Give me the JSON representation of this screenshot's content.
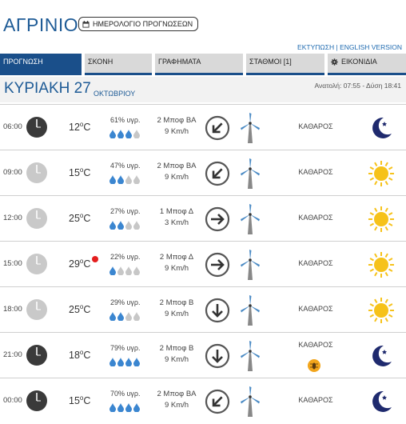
{
  "header": {
    "city": "ΑΓΡΙΝΙΟ",
    "calendar_button": "ΗΜΕΡΟΛΟΓΙΟ ΠΡΟΓΝΩΣΕΩΝ",
    "print_links": "ΕΚΤΥΠΩΣΗ | ENGLISH VERSION"
  },
  "tabs": [
    {
      "label": "ΠΡΟΓΝΩΣΗ",
      "active": true
    },
    {
      "label": "ΣΚΟΝΗ"
    },
    {
      "label": "ΓΡΑΦΗΜΑΤΑ"
    },
    {
      "label": "ΣΤΑΘΜΟΙ [1]"
    },
    {
      "label": "ΕΙΚΟΝΙΔΙΑ",
      "icon": "gear-icon"
    }
  ],
  "day": {
    "title": "ΚΥΡΙΑΚΗ 27",
    "month": "ΟΚΤΩΒΡΙΟΥ",
    "sun": "Ανατολή: 07:55 - Δύση 18:41"
  },
  "colors": {
    "accent": "#1a4f8a",
    "title_blue": "#1e5b96",
    "drop_blue": "#3b86d0",
    "drop_gray": "#c7c7c7",
    "rain_dot": "#e41e1e",
    "sun": "#f6c21a",
    "moon": "#1f2a6e"
  },
  "rows": [
    {
      "time": "06:00",
      "night": true,
      "temp": "12",
      "humidity": "61% υγρ.",
      "drops": 3,
      "wind_bft": "2 Μποφ ΒΑ",
      "wind_kmh": "9 Km/h",
      "wind_dir": "southwest",
      "condition": "ΚΑΘΑΡΟΣ",
      "icon": "moon-icon",
      "rain": false
    },
    {
      "time": "09:00",
      "night": false,
      "temp": "15",
      "humidity": "47% υγρ.",
      "drops": 2,
      "wind_bft": "2 Μποφ ΒΑ",
      "wind_kmh": "9 Km/h",
      "wind_dir": "southwest",
      "condition": "ΚΑΘΑΡΟΣ",
      "icon": "sun-icon",
      "rain": false
    },
    {
      "time": "12:00",
      "night": false,
      "temp": "25",
      "humidity": "27% υγρ.",
      "drops": 2,
      "wind_bft": "1 Μποφ Δ",
      "wind_kmh": "3 Km/h",
      "wind_dir": "east",
      "condition": "ΚΑΘΑΡΟΣ",
      "icon": "sun-icon",
      "rain": false
    },
    {
      "time": "15:00",
      "night": false,
      "temp": "29",
      "humidity": "22% υγρ.",
      "drops": 1,
      "wind_bft": "2 Μποφ Δ",
      "wind_kmh": "9 Km/h",
      "wind_dir": "east",
      "condition": "ΚΑΘΑΡΟΣ",
      "icon": "sun-icon",
      "rain": true
    },
    {
      "time": "18:00",
      "night": false,
      "temp": "25",
      "humidity": "29% υγρ.",
      "drops": 2,
      "wind_bft": "2 Μποφ Β",
      "wind_kmh": "9 Km/h",
      "wind_dir": "south",
      "condition": "ΚΑΘΑΡΟΣ",
      "icon": "sun-icon",
      "rain": false
    },
    {
      "time": "21:00",
      "night": true,
      "temp": "18",
      "humidity": "79% υγρ.",
      "drops": 4,
      "wind_bft": "2 Μποφ Β",
      "wind_kmh": "9 Km/h",
      "wind_dir": "south",
      "condition": "ΚΑΘΑΡΟΣ",
      "icon": "moon-icon",
      "rain": false,
      "sub_icon": "insect-icon"
    },
    {
      "time": "00:00",
      "night": true,
      "temp": "15",
      "humidity": "70% υγρ.",
      "drops": 4,
      "wind_bft": "2 Μποφ ΒΑ",
      "wind_kmh": "9 Km/h",
      "wind_dir": "southwest",
      "condition": "ΚΑΘΑΡΟΣ",
      "icon": "moon-icon",
      "rain": false
    }
  ]
}
